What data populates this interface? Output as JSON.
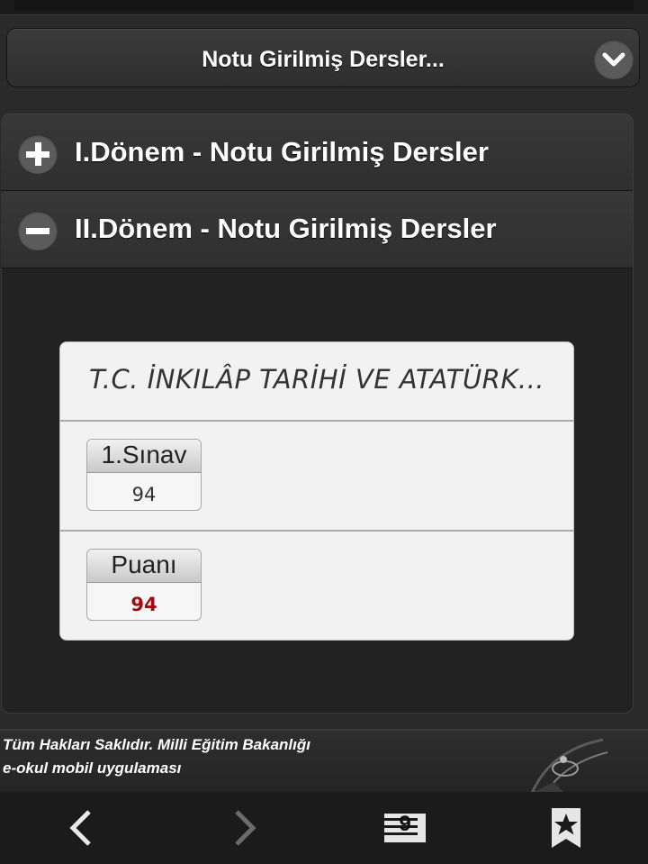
{
  "header": {
    "select_value": "Notu Girilmiş Dersler..."
  },
  "accordion": [
    {
      "label": "I.Dönem - Notu Girilmiş Dersler",
      "state": "collapsed",
      "icon": "plus-icon"
    },
    {
      "label": "II.Dönem - Notu Girilmiş Dersler",
      "state": "expanded",
      "icon": "minus-icon"
    }
  ],
  "course": {
    "title": "T.C. İNKILÂP TARİHİ VE ATATÜRK...",
    "grades": [
      {
        "label": "1.Sınav",
        "value": "94"
      },
      {
        "label": "Puanı",
        "value": "94"
      }
    ]
  },
  "footer": {
    "line1": "Tüm Hakları Saklıdır. Milli Eğitim Bakanlığı",
    "line2": "e-okul mobil uygulaması"
  },
  "nav": {
    "back_icon": "chevron-left-icon",
    "forward_icon": "chevron-right-icon",
    "tabs_count": "9",
    "bookmark_icon": "bookmark-star-icon"
  },
  "colors": {
    "accent_value": "#a10c12"
  }
}
